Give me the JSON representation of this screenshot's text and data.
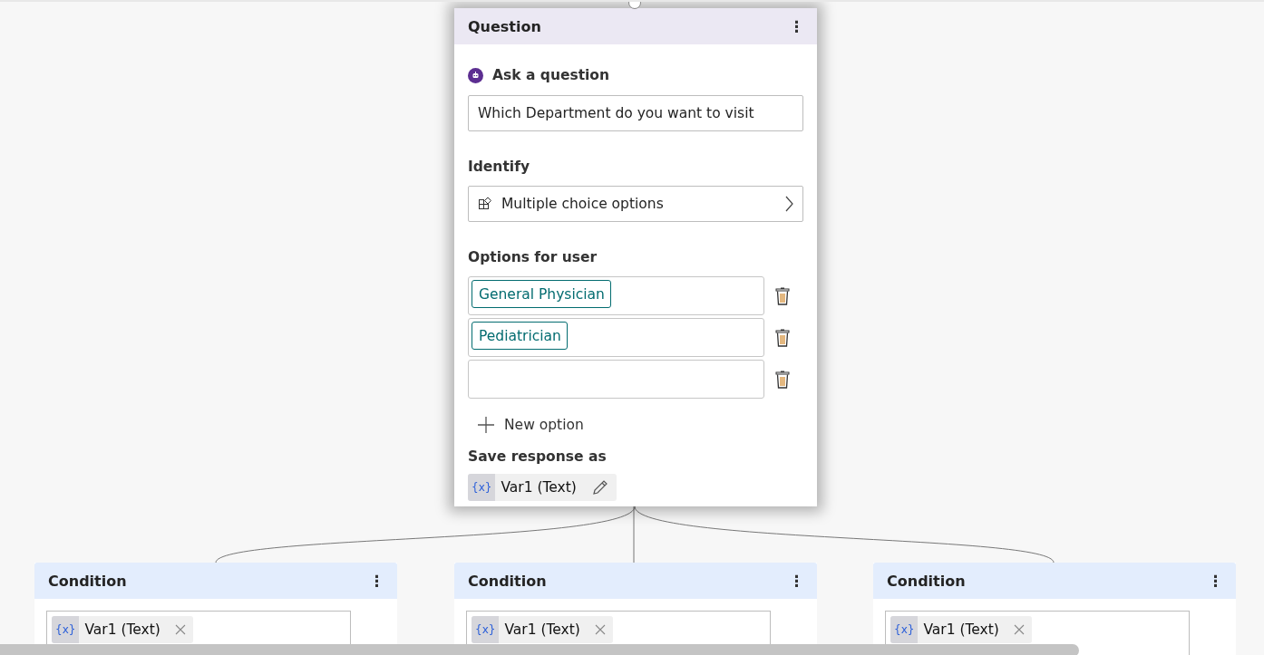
{
  "question_node": {
    "title": "Question",
    "menu": "⋮",
    "prompt_label": "Ask a question",
    "prompt_value": "Which Department do you want to visit",
    "identify_label": "Identify",
    "identify_value": "Multiple choice options",
    "options_label": "Options for user",
    "options": [
      {
        "kind": "tag",
        "value": "General Physician"
      },
      {
        "kind": "tag",
        "value": "Pediatrician"
      },
      {
        "kind": "blank"
      }
    ],
    "new_option": "New option",
    "save_label": "Save response as",
    "variable_badge": "{x}",
    "variable": "Var1 (Text)"
  },
  "condition_nodes": [
    {
      "title": "Condition",
      "menu": "⋮",
      "variable_badge": "{x}",
      "variable": "Var1 (Text)"
    },
    {
      "title": "Condition",
      "menu": "⋮",
      "variable_badge": "{x}",
      "variable": "Var1 (Text)"
    },
    {
      "title": "Condition",
      "menu": "⋮",
      "variable_badge": "{x}",
      "variable": "Var1 (Text)"
    }
  ]
}
